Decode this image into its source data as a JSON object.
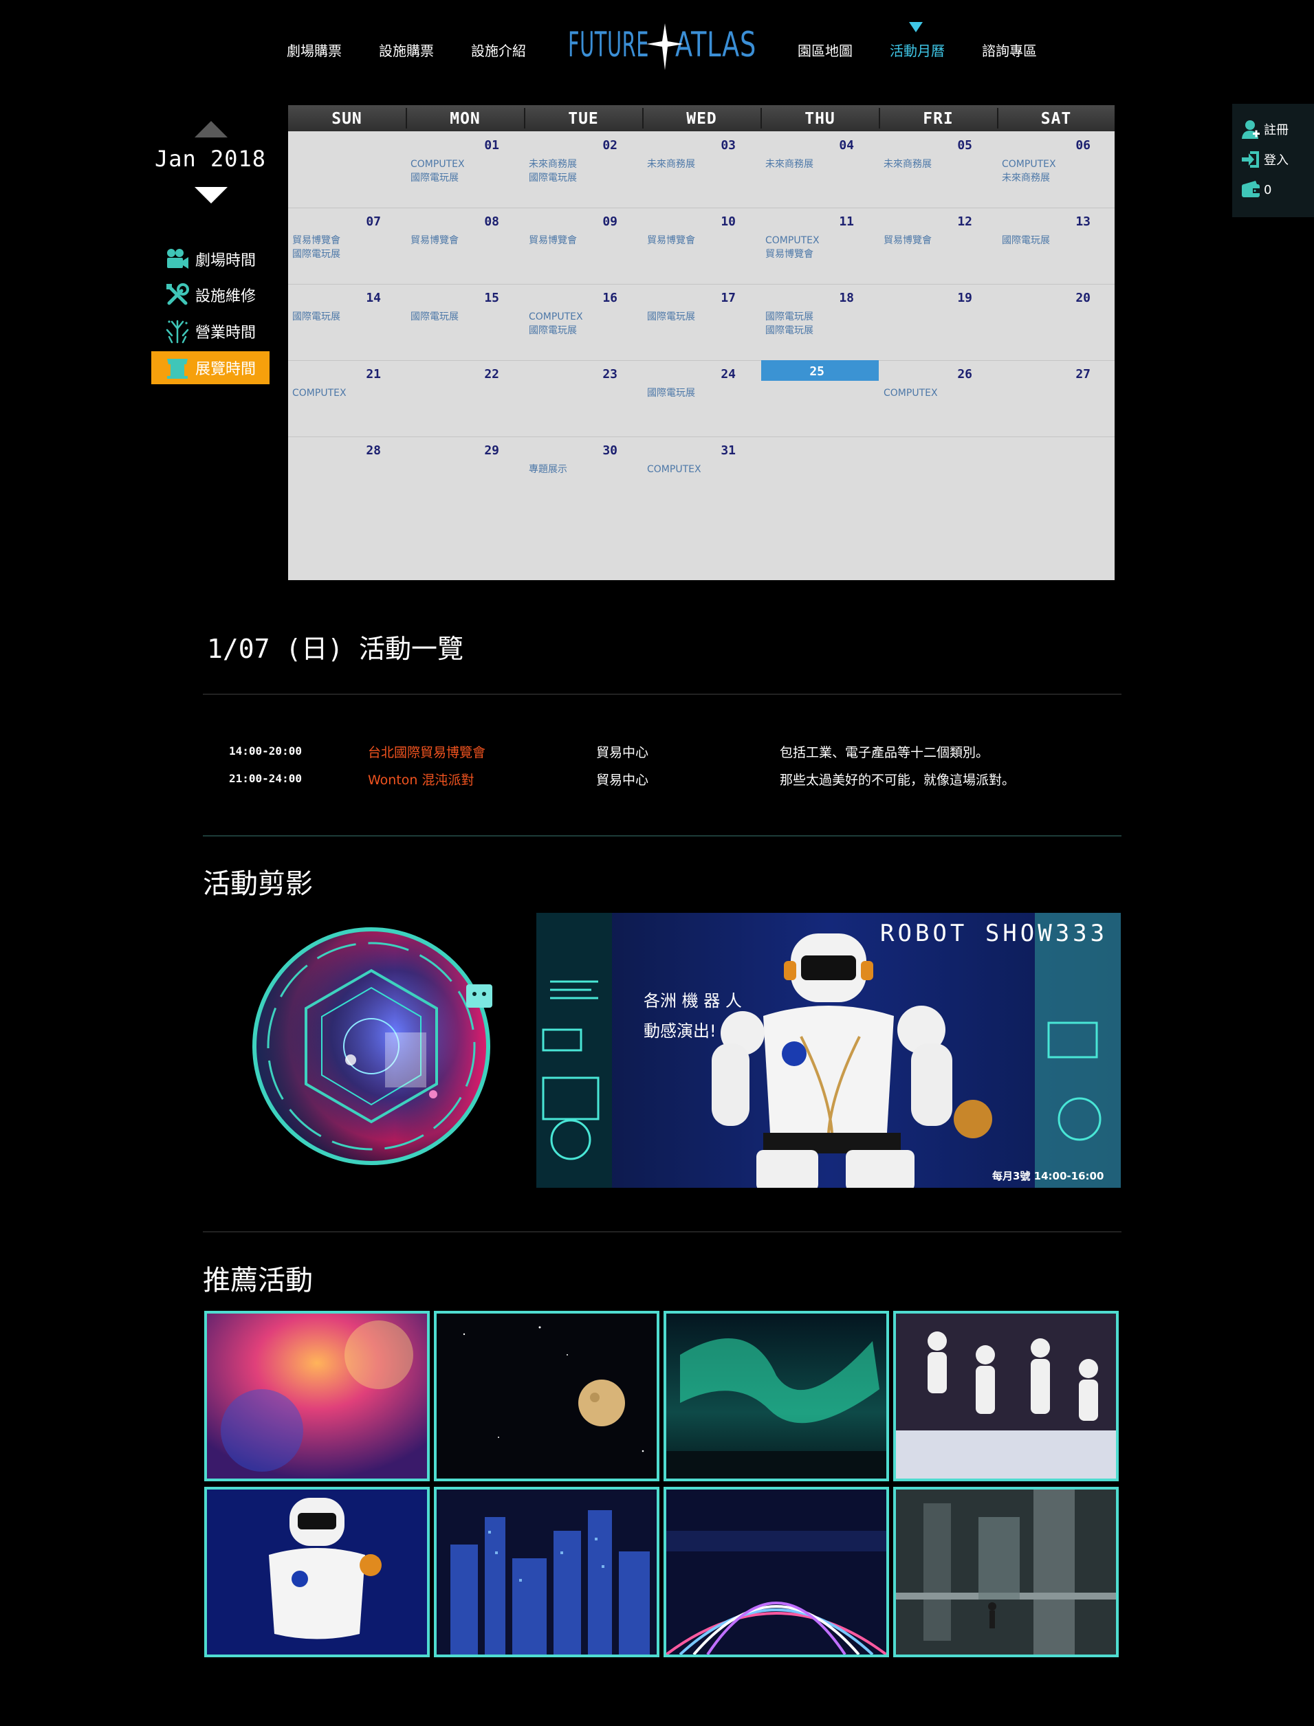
{
  "nav": {
    "left": [
      "劇場購票",
      "設施購票",
      "設施介紹"
    ],
    "logo_text_left": "FUTURE",
    "logo_text_right": "ATLAS",
    "right": [
      "園區地圖",
      "活動月曆",
      "諮詢專區"
    ],
    "active": "活動月曆"
  },
  "user_panel": {
    "register": "註冊",
    "login": "登入",
    "cart_count": "0"
  },
  "month_nav": {
    "label": "Jan 2018"
  },
  "side_menu": [
    {
      "label": "劇場時間",
      "icon": "camera-icon"
    },
    {
      "label": "設施維修",
      "icon": "tools-icon"
    },
    {
      "label": "營業時間",
      "icon": "fireworks-icon"
    },
    {
      "label": "展覽時間",
      "icon": "booth-icon",
      "active": true
    }
  ],
  "calendar": {
    "weekdays": [
      "SUN",
      "MON",
      "TUE",
      "WED",
      "THU",
      "FRI",
      "SAT"
    ],
    "today": "25",
    "weeks": [
      [
        {
          "day": "",
          "events": []
        },
        {
          "day": "01",
          "events": [
            "COMPUTEX",
            "國際電玩展"
          ]
        },
        {
          "day": "02",
          "events": [
            "未來商務展",
            "國際電玩展"
          ]
        },
        {
          "day": "03",
          "events": [
            "未來商務展"
          ]
        },
        {
          "day": "04",
          "events": [
            "未來商務展"
          ]
        },
        {
          "day": "05",
          "events": [
            "未來商務展"
          ]
        },
        {
          "day": "06",
          "events": [
            "COMPUTEX",
            "未來商務展"
          ]
        }
      ],
      [
        {
          "day": "07",
          "events": [
            "貿易博覽會",
            "國際電玩展"
          ]
        },
        {
          "day": "08",
          "events": [
            "貿易博覽會"
          ]
        },
        {
          "day": "09",
          "events": [
            "貿易博覽會"
          ]
        },
        {
          "day": "10",
          "events": [
            "貿易博覽會"
          ]
        },
        {
          "day": "11",
          "events": [
            "COMPUTEX",
            "貿易博覽會"
          ]
        },
        {
          "day": "12",
          "events": [
            "貿易博覽會"
          ]
        },
        {
          "day": "13",
          "events": [
            "國際電玩展"
          ]
        }
      ],
      [
        {
          "day": "14",
          "events": [
            "國際電玩展"
          ]
        },
        {
          "day": "15",
          "events": [
            "國際電玩展"
          ]
        },
        {
          "day": "16",
          "events": [
            "COMPUTEX",
            "國際電玩展"
          ]
        },
        {
          "day": "17",
          "events": [
            "國際電玩展"
          ]
        },
        {
          "day": "18",
          "events": [
            "國際電玩展",
            "國際電玩展"
          ]
        },
        {
          "day": "19",
          "events": []
        },
        {
          "day": "20",
          "events": []
        }
      ],
      [
        {
          "day": "21",
          "events": [
            "COMPUTEX"
          ]
        },
        {
          "day": "22",
          "events": []
        },
        {
          "day": "23",
          "events": []
        },
        {
          "day": "24",
          "events": [
            "國際電玩展"
          ]
        },
        {
          "day": "25",
          "events": []
        },
        {
          "day": "26",
          "events": [
            "COMPUTEX"
          ]
        },
        {
          "day": "27",
          "events": []
        }
      ],
      [
        {
          "day": "28",
          "events": []
        },
        {
          "day": "29",
          "events": []
        },
        {
          "day": "30",
          "events": [
            "專題展示"
          ]
        },
        {
          "day": "31",
          "events": [
            "COMPUTEX"
          ]
        },
        {
          "day": "",
          "events": []
        },
        {
          "day": "",
          "events": []
        },
        {
          "day": "",
          "events": []
        }
      ]
    ]
  },
  "day_list": {
    "title": "1/07 (日) 活動一覽",
    "events": [
      {
        "time": "14:00-20:00",
        "name": "台北國際貿易博覽會",
        "place": "貿易中心",
        "desc": "包括工業、電子產品等十二個類別。"
      },
      {
        "time": "21:00-24:00",
        "name": "Wonton 混沌派對",
        "place": "貿易中心",
        "desc": "那些太過美好的不可能，就像這場派對。"
      }
    ]
  },
  "snapshots": {
    "title": "活動剪影",
    "banner_title": "ROBOT SHOW333",
    "banner_line1": "各洲 機 器 人",
    "banner_line2": "動感演出!",
    "banner_footer": "每月3號 14:00-16:00"
  },
  "recommended": {
    "title": "推薦活動",
    "tiles": [
      "nebula-image",
      "moon-image",
      "aurora-image",
      "robot-band-image",
      "robot-image",
      "city-night-image",
      "light-trails-image",
      "futuristic-station-image"
    ]
  },
  "colors": {
    "accent": "#3fc6e6",
    "active_menu": "#f6a00c",
    "today": "#3b93d3",
    "event_name": "#f0531f",
    "tile_border": "#4fdcd0"
  }
}
